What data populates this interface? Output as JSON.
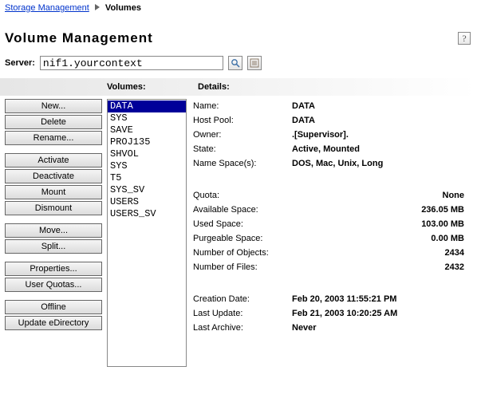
{
  "breadcrumb": {
    "parent": "Storage Management",
    "current": "Volumes"
  },
  "title": "Volume Management",
  "serverLabel": "Server:",
  "serverValue": "nif1.yourcontext",
  "headers": {
    "volumes": "Volumes:",
    "details": "Details:"
  },
  "actions": {
    "new": "New...",
    "delete": "Delete",
    "rename": "Rename...",
    "activate": "Activate",
    "deactivate": "Deactivate",
    "mount": "Mount",
    "dismount": "Dismount",
    "move": "Move...",
    "split": "Split...",
    "properties": "Properties...",
    "userQuotas": "User Quotas...",
    "offline": "Offline",
    "updateEdir": "Update eDirectory"
  },
  "volumes": {
    "items": [
      "DATA",
      "SYS",
      "SAVE",
      "PROJ135",
      "SHVOL",
      "SYS",
      "T5",
      "SYS_SV",
      "USERS",
      "USERS_SV"
    ],
    "selectedIndex": 0
  },
  "details": {
    "labels": {
      "name": "Name:",
      "hostPool": "Host Pool:",
      "owner": "Owner:",
      "state": "State:",
      "nameSpaces": "Name Space(s):",
      "quota": "Quota:",
      "availableSpace": "Available Space:",
      "usedSpace": "Used Space:",
      "purgeableSpace": "Purgeable Space:",
      "numObjects": "Number of Objects:",
      "numFiles": "Number of Files:",
      "creationDate": "Creation Date:",
      "lastUpdate": "Last Update:",
      "lastArchive": "Last Archive:"
    },
    "values": {
      "name": "DATA",
      "hostPool": "DATA",
      "owner": ".[Supervisor].",
      "state": "Active, Mounted",
      "nameSpaces": "DOS, Mac, Unix, Long",
      "quota": "None",
      "availableSpace": "236.05 MB",
      "usedSpace": "103.00 MB",
      "purgeableSpace": "0.00 MB",
      "numObjects": "2434",
      "numFiles": "2432",
      "creationDate": "Feb 20, 2003 11:55:21 PM",
      "lastUpdate": "Feb 21, 2003 10:20:25 AM",
      "lastArchive": "Never"
    }
  }
}
